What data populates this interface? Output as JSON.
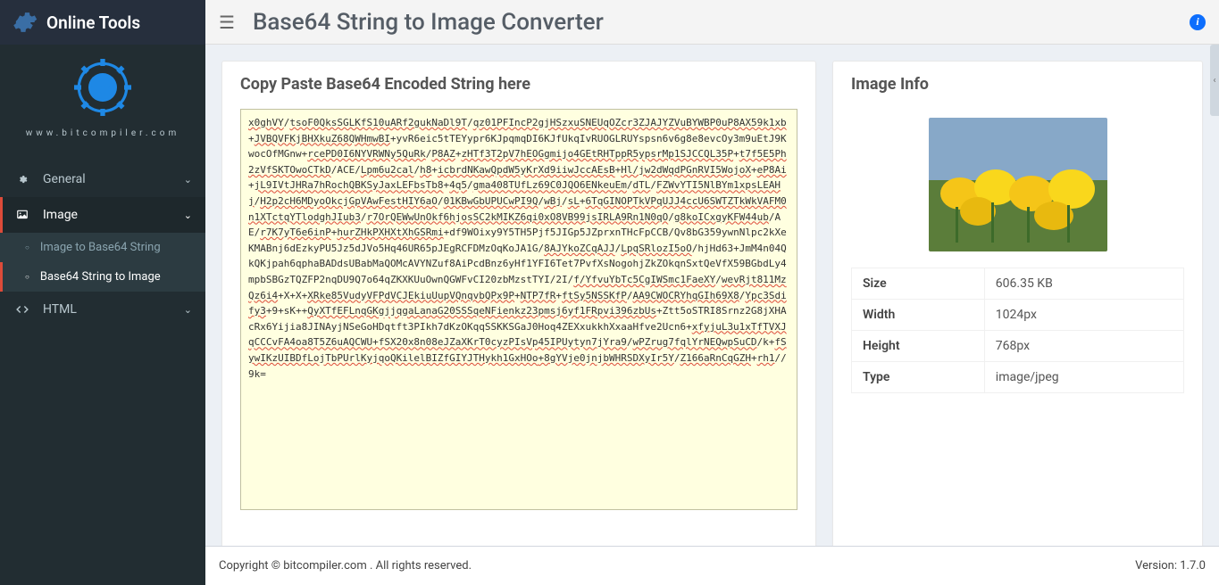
{
  "brand": {
    "name": "Online Tools",
    "domain": "www.bitcompiler.com"
  },
  "page_title": "Base64 String to Image Converter",
  "sidebar": {
    "items": [
      {
        "icon": "gear",
        "label": "General",
        "expanded": false
      },
      {
        "icon": "image",
        "label": "Image",
        "expanded": true,
        "active": true,
        "children": [
          {
            "label": "Image to Base64 String",
            "current": false
          },
          {
            "label": "Base64 String to Image",
            "current": true
          }
        ]
      },
      {
        "icon": "code",
        "label": "HTML",
        "expanded": false
      }
    ]
  },
  "input_card": {
    "title": "Copy Paste Base64 Encoded String here",
    "content_segments": [
      {
        "t": "x0ghVY",
        "u": 1
      },
      {
        "t": "/"
      },
      {
        "t": "tsoF0QksSGLKfS10uARf2gukNaDl9T",
        "u": 1
      },
      {
        "t": "/"
      },
      {
        "t": "qz01PFIncP2gjHSzxuSNEUqOZcr3ZJAJYZVuBYWBP0uP8AX59k1xb",
        "u": 1
      },
      {
        "t": "+"
      },
      {
        "t": "JVBQVFKjBHXkuZ68QWHmwBI",
        "u": 1
      },
      {
        "t": "+yvR6eic5tTEYypr6KJpqmqDI6KJfUkqIvRUOGLRUYspsn6v6g8e8evcOy3m9uEtJ9KwocOfMGnw+"
      },
      {
        "t": "rcePD0I6NYVRWNy5QuRk",
        "u": 1
      },
      {
        "t": "/"
      },
      {
        "t": "P8AZ",
        "u": 1
      },
      {
        "t": "+"
      },
      {
        "t": "zHTf3T2pV7hEOGgmijo4GEtRHTppR5ypsrMp1SJCCQL35P",
        "u": 1
      },
      {
        "t": "+"
      },
      {
        "t": "t7f5E5Ph2zVfSKTOwoCTkD",
        "u": 1
      },
      {
        "t": "/ACE/"
      },
      {
        "t": "Lpm6u2cal",
        "u": 1
      },
      {
        "t": "/"
      },
      {
        "t": "h8",
        "u": 1
      },
      {
        "t": "+"
      },
      {
        "t": "icbrdNKawQpdW5yKrXd9iiwJccAEsB",
        "u": 1
      },
      {
        "t": "+"
      },
      {
        "t": "Hl/jw2dWqdPGnRVI5WojoX",
        "u": 1
      },
      {
        "t": "+"
      },
      {
        "t": "eP8Ai",
        "u": 1
      },
      {
        "t": "+"
      },
      {
        "t": "jL9IVtJHRa7hRochQBKSyJaxLEFbsTb8",
        "u": 1
      },
      {
        "t": "+"
      },
      {
        "t": "4q5",
        "u": 1
      },
      {
        "t": "/"
      },
      {
        "t": "gma408TUfLz69C0JQO6ENkeuEm",
        "u": 1
      },
      {
        "t": "/"
      },
      {
        "t": "dTL",
        "u": 1
      },
      {
        "t": "/"
      },
      {
        "t": "FZWvYTI5NlBYm1xpsLEAHj",
        "u": 1
      },
      {
        "t": "/"
      },
      {
        "t": "H2p2cH6MDyoOkcjGpVAwFestHIY6aO",
        "u": 1
      },
      {
        "t": "/"
      },
      {
        "t": "01KBwGbUPUCwPI9Q",
        "u": 1
      },
      {
        "t": "/"
      },
      {
        "t": "wBj",
        "u": 1
      },
      {
        "t": "/"
      },
      {
        "t": "sL",
        "u": 1
      },
      {
        "t": "+"
      },
      {
        "t": "6TqGINOPTkVPqUJJ4ccU6SWTZTkWkVAFM0n1XTctqYTlodghJIub3",
        "u": 1
      },
      {
        "t": "/"
      },
      {
        "t": "r7OrQEWwUnOkf6hjosSC2kMIKZ6qi0xO8VB99jsIRLA9Rn1N0qO",
        "u": 1
      },
      {
        "t": "/"
      },
      {
        "t": "g8koICxgyKFW44ub",
        "u": 1
      },
      {
        "t": "/AE/"
      },
      {
        "t": "r7K7yT6e6inP",
        "u": 1
      },
      {
        "t": "+"
      },
      {
        "t": "hurZHkPXHXtXhGSRmi",
        "u": 1
      },
      {
        "t": "+df9WOixy9Y5TH5Pjf5JIGp5JZprxnTHcFpCCB/Qv8bG359ywnNlpc2kXeKMABnj6dEzkyPU5Jz5dJVo5Hq46UR65pJEgRCFDMzOqKoJA1G/"
      },
      {
        "t": "8AJYkoZCqAJJ",
        "u": 1
      },
      {
        "t": "/"
      },
      {
        "t": "LpqSRlozI5oO",
        "u": 1
      },
      {
        "t": "/hjHd63+JmM4n04QkQKjpah6qphaBADdsUBabMaQOMcAVYNZuf8AiPcdBnz6yHf1YFI6Tet7PvfXsNogohjZkZOkqnSxtQeVfX59BGbdLy4mpbSBGzTQZFP2nqDU9Q7o64qZKXKUuOwnQGWFvCI20zbMzstTYI/2I/"
      },
      {
        "t": "f/YfvuYbTc5CgIWSmc1FaeXY",
        "u": 1
      },
      {
        "t": "/"
      },
      {
        "t": "wevRjt811MzQz6i4",
        "u": 1
      },
      {
        "t": "+X+X+"
      },
      {
        "t": "XRke85VudyVFPdVCJEkiuUupVQnqvbQPx9P",
        "u": 1
      },
      {
        "t": "+"
      },
      {
        "t": "NTP7fR",
        "u": 1
      },
      {
        "t": "+"
      },
      {
        "t": "ftSy5NSSKfP",
        "u": 1
      },
      {
        "t": "/"
      },
      {
        "t": "AA9CWOCRYhqGIh69X8",
        "u": 1
      },
      {
        "t": "/"
      },
      {
        "t": "Ypc3Sdify3",
        "u": 1
      },
      {
        "t": "+9+sK++"
      },
      {
        "t": "QyXTfEFLnqGKgjjqgaLanaG20SSSqeNFienkz23pmsj6yf1FRpvi396zbUs",
        "u": 1
      },
      {
        "t": "+Ztt5oSTRI8Srnz2G8jXHAcRx6Yijia8JINAyjNSeGoHDqtft3PIkh7dKzOKqqSSKKSGaJ0Hoq4ZEXxukkhXxaaHfve2Ucn6+"
      },
      {
        "t": "xfyjuL3u1xTfTVXJqCCCvFA4oa8T5Z6uAQCWU",
        "u": 1
      },
      {
        "t": "+fSX20x8n08eJZaXKrT0cyzPIsVp45IPUytyn7jYra9",
        "u": 1
      },
      {
        "t": "/"
      },
      {
        "t": "wPZrug7fqlYrNEQwpSuCD",
        "u": 1
      },
      {
        "t": "/k+"
      },
      {
        "t": "fSywIKzUIBDfLojTbPUrlKyjqoQKilelBIZfGIYJTHykh1GxHOo",
        "u": 1
      },
      {
        "t": "+8gYVje0jnjbWHRSDXyIr5Y",
        "u": 1
      },
      {
        "t": "/"
      },
      {
        "t": "Z166aRnCqGZH",
        "u": 1
      },
      {
        "t": "+"
      },
      {
        "t": "rh1",
        "u": 1
      },
      {
        "t": "//9k="
      }
    ]
  },
  "info_card": {
    "title": "Image Info",
    "rows": [
      {
        "k": "Size",
        "v": "606.35 KB"
      },
      {
        "k": "Width",
        "v": "1024px"
      },
      {
        "k": "Height",
        "v": "768px"
      },
      {
        "k": "Type",
        "v": "image/jpeg"
      }
    ]
  },
  "footer": {
    "copyright": "Copyright © bitcompiler.com . All rights reserved.",
    "version": "Version: 1.7.0"
  }
}
